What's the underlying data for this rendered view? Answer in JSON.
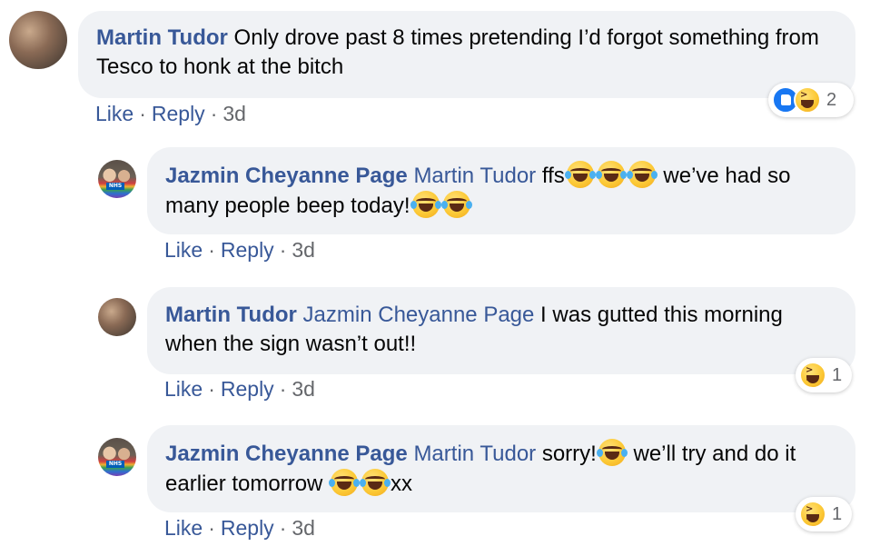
{
  "comments": [
    {
      "author": "Martin Tudor",
      "mention": "",
      "text": "Only drove past 8 times pretending I’d forgot something from Tesco to honk at the bitch",
      "like": "Like",
      "reply": "Reply",
      "time": "3d",
      "reaction_count": "2",
      "reactions": [
        "like-icon",
        "haha-icon"
      ]
    },
    {
      "author": "Jazmin Cheyanne Page",
      "mention": "Martin Tudor",
      "text_a": "ffs",
      "text_b": " we’ve had so many people beep today!",
      "like": "Like",
      "reply": "Reply",
      "time": "3d"
    },
    {
      "author": "Martin Tudor",
      "mention": "Jazmin Cheyanne Page",
      "text": "I was gutted this morning when the sign wasn’t out!!",
      "like": "Like",
      "reply": "Reply",
      "time": "3d",
      "reaction_count": "1",
      "reactions": [
        "haha-icon"
      ]
    },
    {
      "author": "Jazmin Cheyanne Page",
      "mention": "Martin Tudor",
      "text_a": "sorry!",
      "text_b": " we’ll try and do it earlier tomorrow ",
      "text_c": "xx",
      "like": "Like",
      "reply": "Reply",
      "time": "3d",
      "reaction_count": "1",
      "reactions": [
        "haha-icon"
      ]
    }
  ],
  "separator": "·",
  "avatar_badge": "NHS",
  "colors": {
    "bubble": "#f0f2f5",
    "link": "#385898",
    "meta": "#65676b",
    "like_reaction": "#1877f2"
  }
}
